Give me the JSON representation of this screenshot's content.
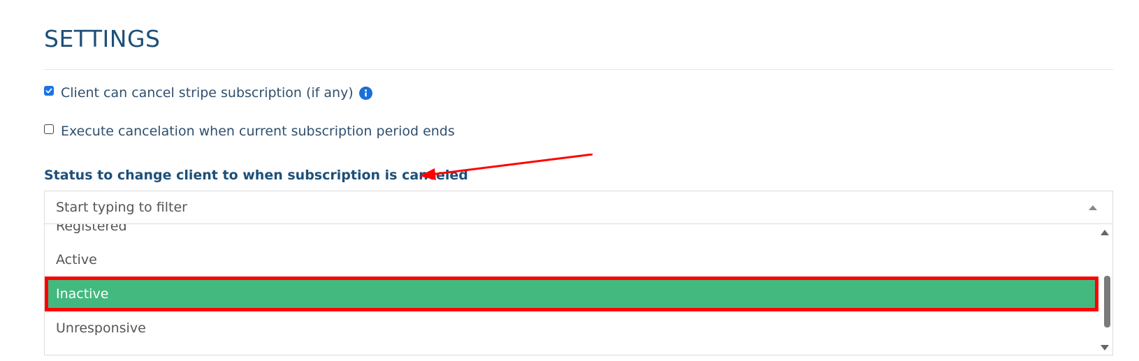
{
  "header": {
    "title": "SETTINGS"
  },
  "options": {
    "cancel_subscription": {
      "label": "Client can cancel stripe subscription (if any)",
      "checked": true
    },
    "execute_at_period_end": {
      "label": "Execute cancelation when current subscription period ends",
      "checked": false
    }
  },
  "status_field": {
    "label": "Status to change client to when subscription is canceled",
    "placeholder": "Start typing to filter",
    "items": [
      {
        "label": "Registered"
      },
      {
        "label": "Active"
      },
      {
        "label": "Inactive",
        "highlighted": true
      },
      {
        "label": "Unresponsive"
      }
    ]
  },
  "colors": {
    "accent": "#1d4f79",
    "highlight": "#43b97f",
    "annotation": "#ff0000",
    "checkbox": "#1a73e8"
  },
  "icons": {
    "info": "info-icon",
    "caret": "caret-up-icon",
    "arrow": "annotation-arrow-icon"
  }
}
